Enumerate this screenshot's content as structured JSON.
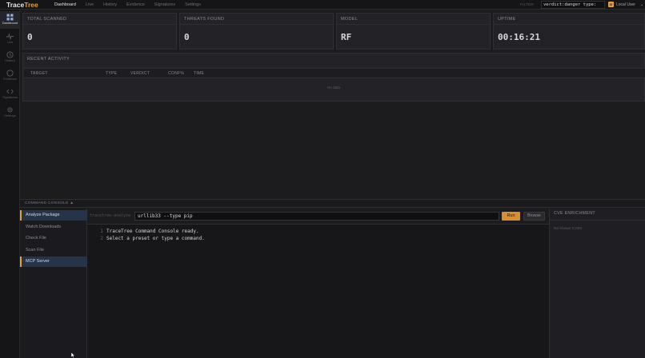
{
  "app": {
    "brand_prefix": "Trace",
    "brand_suffix": "Tree"
  },
  "nav": {
    "items": [
      "Dashboard",
      "Live",
      "History",
      "Evidence",
      "Signatures",
      "Settings"
    ],
    "active": "Dashboard"
  },
  "filter": {
    "label": "FILTER",
    "value": "verdict:danger type:"
  },
  "user": {
    "initial": "U",
    "name": "Local User",
    "caret": "⌄"
  },
  "sidebar": {
    "items": [
      "Dashboard",
      "Live",
      "History",
      "Evidence",
      "Signatures",
      "Settings"
    ],
    "active": "Dashboard"
  },
  "stats": [
    {
      "title": "TOTAL SCANNED",
      "value": "0"
    },
    {
      "title": "THREATS FOUND",
      "value": "0"
    },
    {
      "title": "MODEL",
      "value": "RF"
    },
    {
      "title": "UPTIME",
      "value": "00:16:21"
    }
  ],
  "activity": {
    "title": "RECENT ACTIVITY",
    "columns": [
      "TARGET",
      "TYPE",
      "VERDICT",
      "CONF%",
      "TIME"
    ],
    "empty_text": "No data"
  },
  "console": {
    "bar_label": "COMMAND CONSOLE ▲",
    "presets": [
      "Analyze Package",
      "Watch Downloads",
      "Check File",
      "Scan File",
      "MCP Server"
    ],
    "prompt": "tracetree-analyze",
    "input_value": "urllib33 --type pip",
    "run_label": "Run",
    "browse_label": "Browse",
    "output": [
      {
        "n": "1",
        "text": "TraceTree Command Console ready."
      },
      {
        "n": "2",
        "text": "Select a preset or type a command."
      }
    ]
  },
  "cve": {
    "title": "CVE ENRICHMENT",
    "empty_text": "No known CVEs"
  },
  "colors": {
    "accent": "#e3a13b",
    "active_preset_bg": "#26344a",
    "run_button": "#d98e2f"
  }
}
